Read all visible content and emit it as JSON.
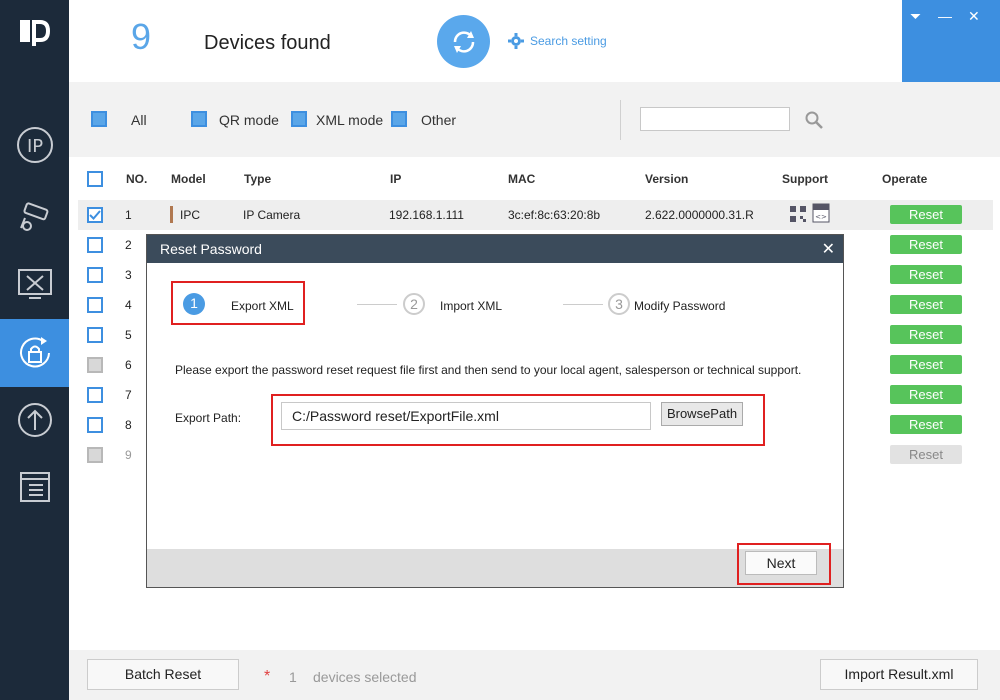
{
  "header": {
    "device_count": "9",
    "devices_found": "Devices found",
    "search_setting": "Search setting"
  },
  "filters": {
    "all": "All",
    "qr_mode": "QR mode",
    "xml_mode": "XML mode",
    "other": "Other",
    "search_placeholder": ""
  },
  "table": {
    "columns": [
      "NO.",
      "Model",
      "Type",
      "IP",
      "MAC",
      "Version",
      "Support",
      "Operate"
    ],
    "rows": [
      {
        "no": "1",
        "model": "IPC",
        "type": "IP Camera",
        "ip": "192.168.1.111",
        "mac": "3c:ef:8c:63:20:8b",
        "version": "2.622.0000000.31.R",
        "action": "Reset"
      },
      {
        "no": "2",
        "action": "Reset"
      },
      {
        "no": "3",
        "action": "Reset"
      },
      {
        "no": "4",
        "action": "Reset"
      },
      {
        "no": "5",
        "action": "Reset"
      },
      {
        "no": "6",
        "action": "Reset"
      },
      {
        "no": "7",
        "action": "Reset"
      },
      {
        "no": "8",
        "action": "Reset"
      },
      {
        "no": "9",
        "action": "Reset"
      }
    ]
  },
  "dialog": {
    "title": "Reset Password",
    "steps": [
      {
        "num": "1",
        "label": "Export XML"
      },
      {
        "num": "2",
        "label": "Import XML"
      },
      {
        "num": "3",
        "label": "Modify Password"
      }
    ],
    "instruction": "Please export the password reset request file first and then send to your local agent, salesperson or technical support.",
    "export_path_label": "Export Path:",
    "export_path_value": "C:/Password reset/ExportFile.xml",
    "browse_label": "BrowsePath",
    "next_label": "Next"
  },
  "bottom": {
    "batch_reset": "Batch Reset",
    "star": "*",
    "selected_count": "1",
    "selected_text": "devices selected",
    "import_result": "Import Result.xml"
  },
  "colors": {
    "accent": "#3d8fe0",
    "sidebar": "#1c2a3a",
    "reset_green": "#57c45b",
    "highlight_red": "#e02020"
  }
}
